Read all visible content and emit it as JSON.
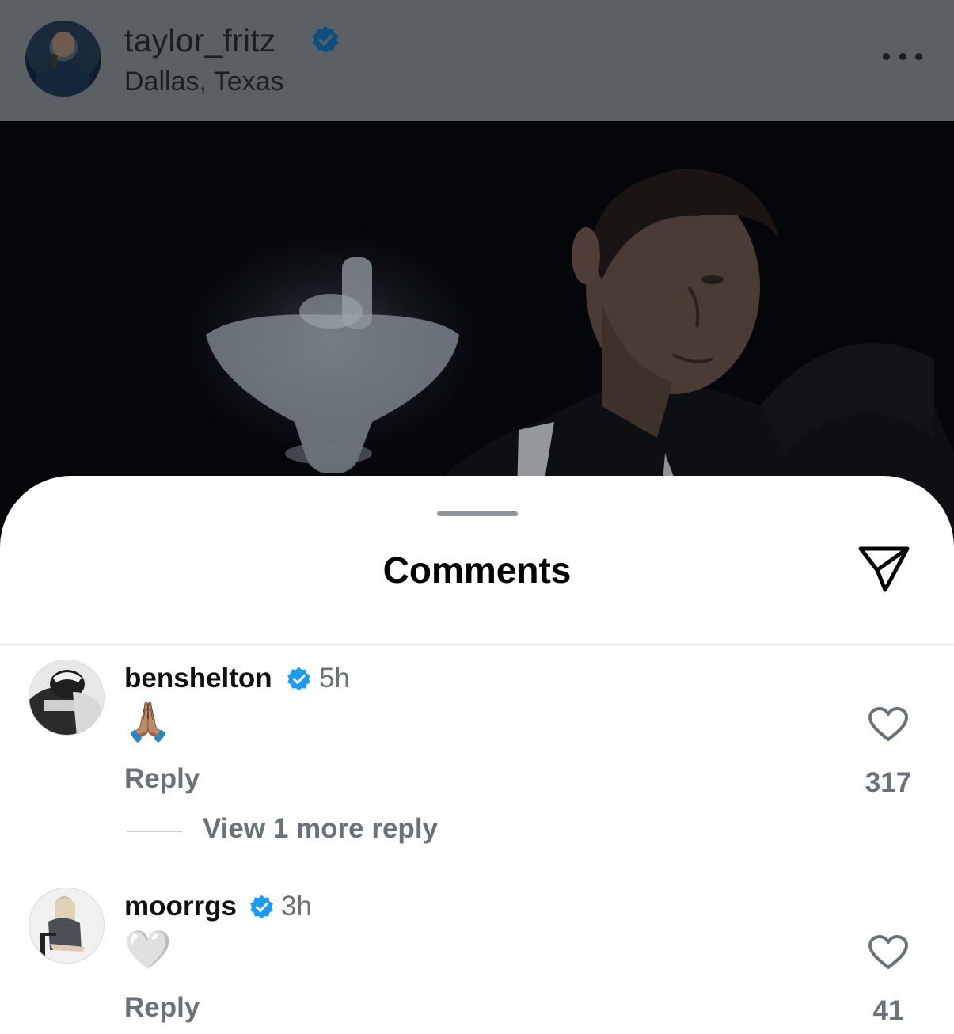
{
  "post": {
    "username": "taylor_fritz",
    "location": "Dallas, Texas",
    "verified": true
  },
  "sheet": {
    "title": "Comments"
  },
  "comments": [
    {
      "username": "benshelton",
      "verified": true,
      "time": "5h",
      "text": "🙏🏽",
      "reply_label": "Reply",
      "likes": "317",
      "more_replies": "View 1 more reply"
    },
    {
      "username": "moorrgs",
      "verified": true,
      "time": "3h",
      "text": "🤍",
      "reply_label": "Reply",
      "likes": "41"
    }
  ],
  "colors": {
    "verified_blue": "#1d9bf0",
    "dimmed_header": "#5b6064",
    "muted_text": "#6a7279"
  },
  "icons": {
    "more": "more-horizontal-icon",
    "share": "paper-plane-icon",
    "like": "heart-outline-icon",
    "verified": "verified-badge-icon"
  }
}
